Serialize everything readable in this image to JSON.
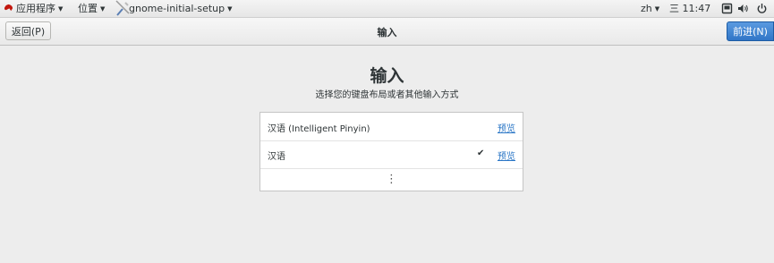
{
  "top_panel": {
    "applications_label": "应用程序",
    "places_label": "位置",
    "active_app_label": "gnome-initial-setup",
    "input_indicator": "zh",
    "clock": "三 11:47"
  },
  "header": {
    "back_label": "返回(P)",
    "title": "输入",
    "next_label": "前进(N)"
  },
  "main": {
    "title": "输入",
    "subtitle": "选择您的键盘布局或者其他输入方式",
    "sources": [
      {
        "name": "汉语 (Intelligent Pinyin)",
        "checked": "",
        "preview": "预览"
      },
      {
        "name": "汉语",
        "checked": "✔",
        "preview": "预览"
      }
    ],
    "more_glyph": "⋮"
  },
  "colors": {
    "accent": "#3176c7",
    "link": "#2a76c6"
  },
  "icons": [
    "app-menu-icon",
    "app-icon",
    "screen-icon",
    "volume-icon",
    "power-icon"
  ]
}
